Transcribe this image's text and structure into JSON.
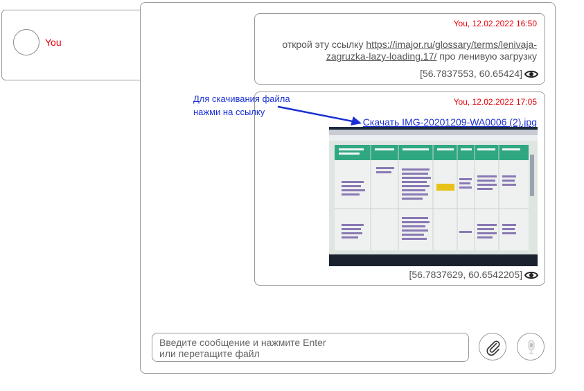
{
  "user_panel": {
    "name": "You"
  },
  "messages": [
    {
      "meta": "You, 12.02.2022 16:50",
      "text_before": "открой эту ссылку ",
      "link": "https://imajor.ru/glossary/terms/lenivaja-zagruzka-lazy-loading.17/",
      "text_after": " про ленивую загрузку",
      "coords": "[56.7837553, 60.65424]"
    },
    {
      "meta": "You, 12.02.2022 17:05",
      "download_label": "Скачать IMG-20201209-WA0006 (2).jpg",
      "coords": "[56.7837629, 60.6542205]"
    }
  ],
  "annotation": {
    "line1": "Для скачивания файла",
    "line2": "нажми на ссылку"
  },
  "composer": {
    "placeholder": "Введите сообщение и нажмите Enter\n        или перетащите файл"
  },
  "icons": {
    "view": "eye-icon",
    "attach": "paperclip-icon",
    "record": "microphone-icon"
  },
  "colors": {
    "meta_red": "#e8000b",
    "link_blue": "#1a2fd4",
    "border_gray": "#999999"
  }
}
